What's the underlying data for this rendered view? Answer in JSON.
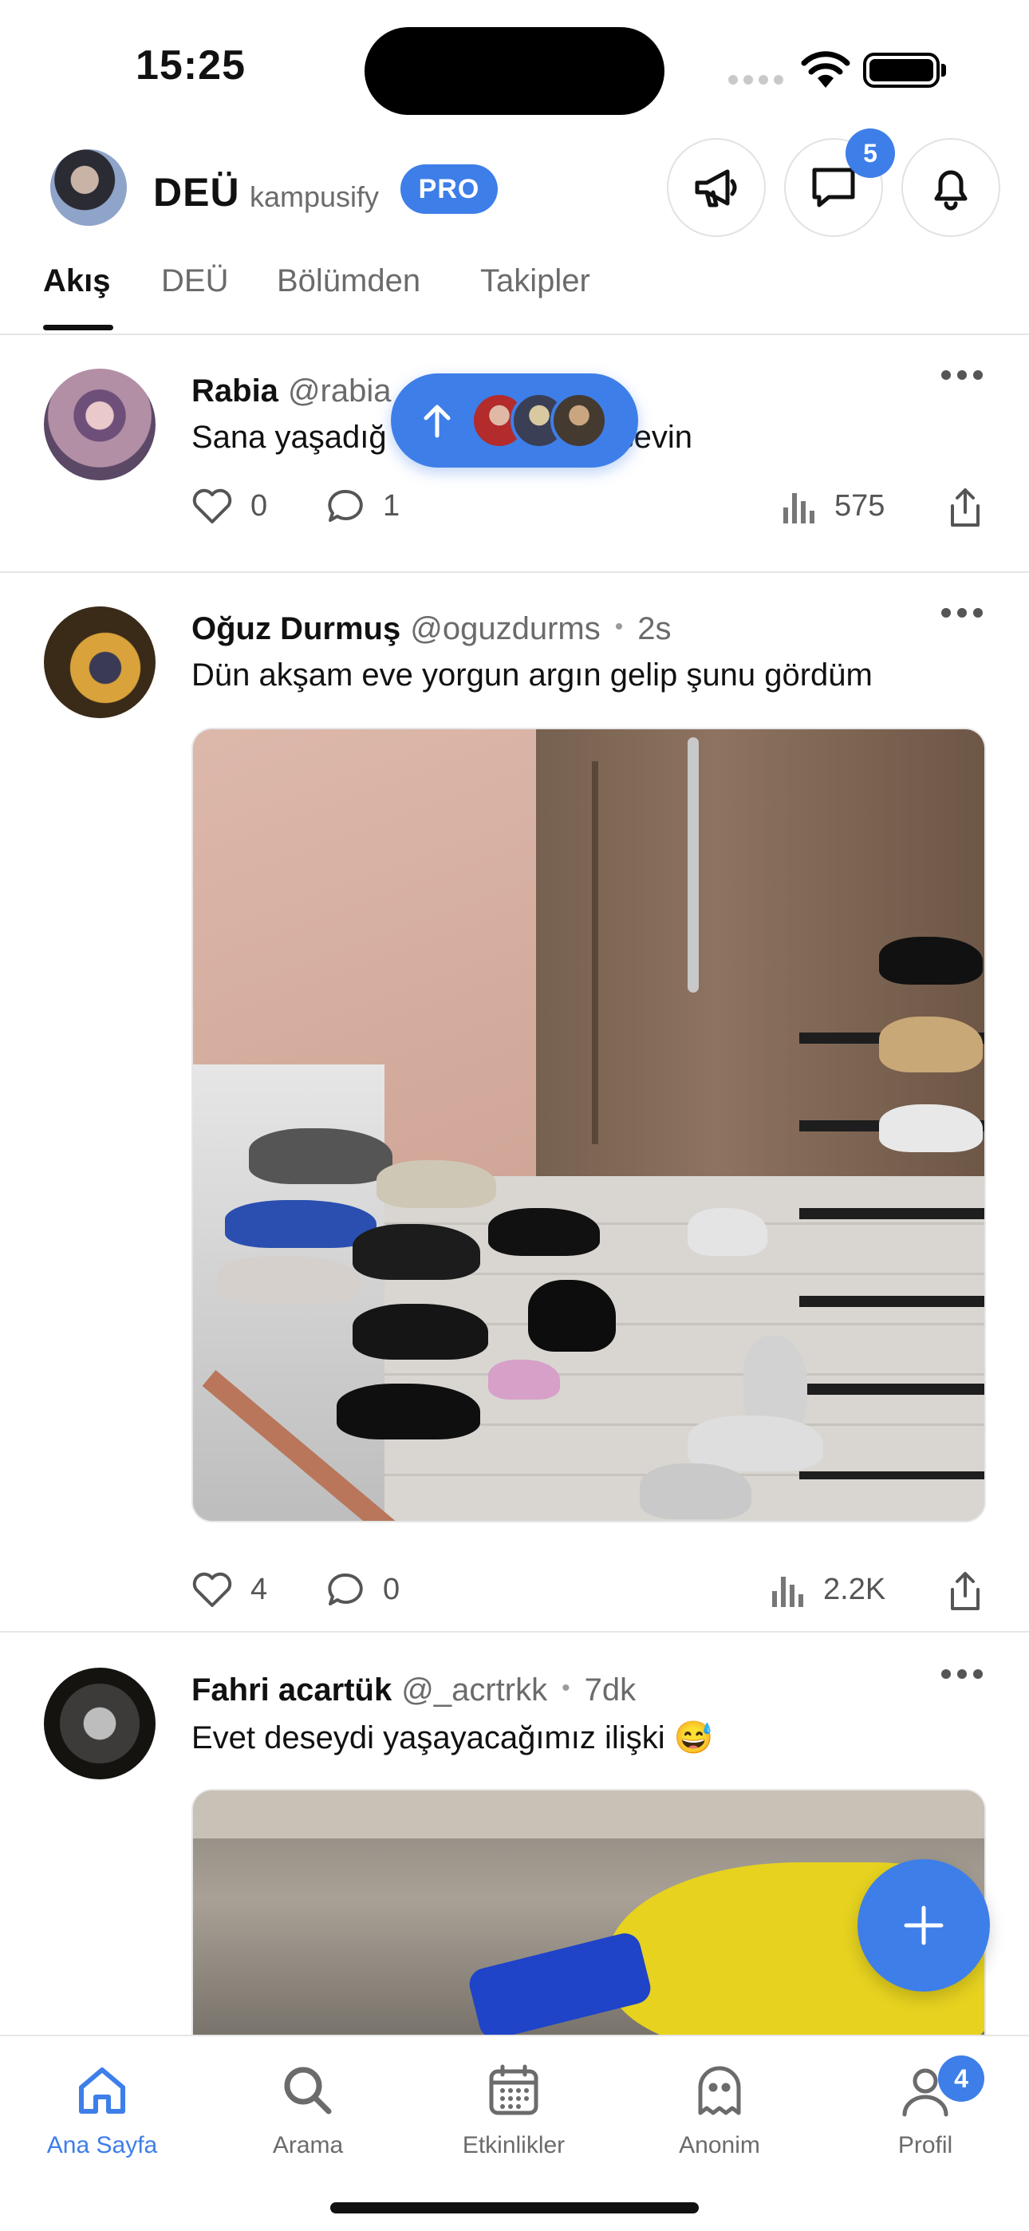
{
  "status_bar": {
    "time": "15:25"
  },
  "header": {
    "brand": "DEÜ",
    "subtitle": "kampusify",
    "pro_badge": "PRO",
    "messages_badge": "5"
  },
  "tabs": [
    "Akış",
    "DEÜ",
    "Bölümden",
    "Takipler"
  ],
  "posts": [
    {
      "name": "Rabia",
      "handle": "@rabia",
      "text": "Sana yaşadığ",
      "text_end": "ışiyi sevin",
      "likes": "0",
      "comments": "1",
      "views": "575"
    },
    {
      "name": "Oğuz Durmuş",
      "handle": "@oguzdurms",
      "dot": "•",
      "time": "2s",
      "text": "Dün akşam eve yorgun argın gelip şunu gördüm",
      "likes": "4",
      "comments": "0",
      "views": "2.2K"
    },
    {
      "name": "Fahri acartük",
      "handle": "@_acrtrkk",
      "dot": "•",
      "time": "7dk",
      "text": "Evet deseydi yaşayacağımız ilişki 😅"
    }
  ],
  "bottom_nav": [
    {
      "label": "Ana Sayfa",
      "icon": "home-icon"
    },
    {
      "label": "Arama",
      "icon": "search-icon"
    },
    {
      "label": "Etkinlikler",
      "icon": "calendar-icon"
    },
    {
      "label": "Anonim",
      "icon": "ghost-icon"
    },
    {
      "label": "Profil",
      "icon": "profile-icon",
      "badge": "4"
    }
  ],
  "colors": {
    "accent": "#3e7ee8",
    "text": "#111111",
    "muted": "#6b6b6b"
  }
}
